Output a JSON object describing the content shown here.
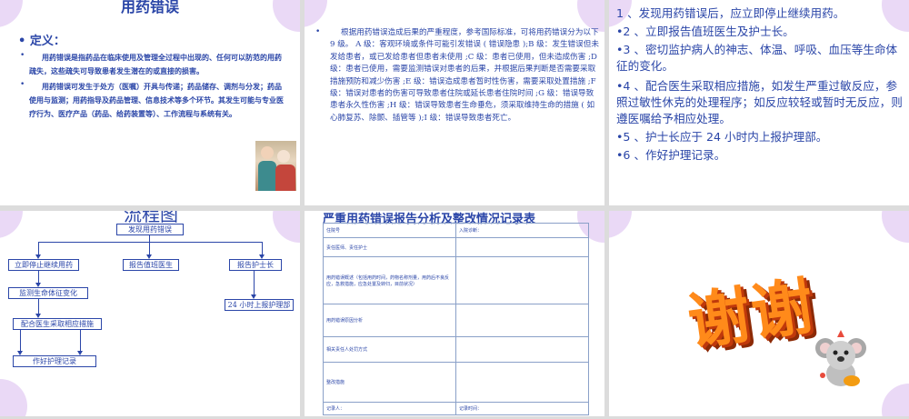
{
  "slide1": {
    "title": "用药错误",
    "definition_label": "• 定义：",
    "para1": "用药错误是指药品在临床使用及管理全过程中出现的、任何可以防范的用药疏失，这些疏失可导致患者发生潜在的或直接的损害。",
    "para2": "用药错误可发生于处方（医嘱）开具与传递；药品储存、调剂与分发；药品使用与监测；用药指导及药品管理、信息技术等多个环节。其发生可能与专业医疗行为、医疗产品（药品、给药装置等）、工作流程与系统有关。"
  },
  "slide2": {
    "text": "根据用药错误造成后果的严重程度，参考国际标准，可将用药错误分为以下 9 级。 A 级：客观环境或条件可能引发错误 ( 错误隐患 );B 级：发生错误但未发给患者，或已发给患者但患者未使用 ;C 级：患者已使用，但未造成伤害 ;D 级：患者已使用，需要监测错误对患者的后果，并根据后果判断是否需要采取措施预防和减少伤害 ;E 级：错误造成患者暂时性伤害，需要采取处置措施 ;F 级：错误对患者的伤害可导致患者住院或延长患者住院时间 ;G 级：错误导致患者永久性伤害 ;H 级：错误导致患者生命垂危，须采取维持生命的措施 ( 如心肺复苏、除颤、插管等 );I 级：错误导致患者死亡。"
  },
  "slide3": {
    "items": [
      " 1 、发现用药错误后，应立即停止继续用药。",
      "•2 、立即报告值班医生及护士长。",
      "•3 、密切监护病人的神志、体温、呼吸、血压等生命体征的变化。",
      "•4 、配合医生采取相应措施，如发生严重过敏反应，参照过敏性休克的处理程序；如反应较轻或暂时无反应，则遵医嘱给予相应处理。",
      "•5 、护士长应于 24 小时内上报护理部。",
      "•6 、作好护理记录。"
    ]
  },
  "slide4": {
    "title": "流程图",
    "top": "发现用药错误",
    "stop": "立即停止继续用药",
    "report_doctor": "报告值班医生",
    "report_head": "报告护士长",
    "monitor": "监测生命体征变化",
    "cooperate": "配合医生采取相应措施",
    "report_24h": "24 小时上报护理部",
    "record": "作好护理记录"
  },
  "slide5": {
    "title": "严重用药错误报告分析及整改情况记录表",
    "rows": {
      "patient_name": "住院号",
      "admission_dx": "入院诊断：",
      "ward": "责任医师、责任护士",
      "event": "用药错误概述（包括用药时间，药物名称剂量，用药后不良反应，急救措施，应急处置及转归，目前状况）",
      "analysis": "用药错误原因分析",
      "responsible": "相关责任人处罚方式",
      "rectify": "整改措施",
      "recorder": "记录人：",
      "record_time": "记录时间："
    }
  },
  "slide6": {
    "thanks": "谢谢"
  },
  "colors": {
    "text_blue": "#2b46a8",
    "accent_orange": "#ff8a1a",
    "deco_lilac": "#ead9f6"
  }
}
